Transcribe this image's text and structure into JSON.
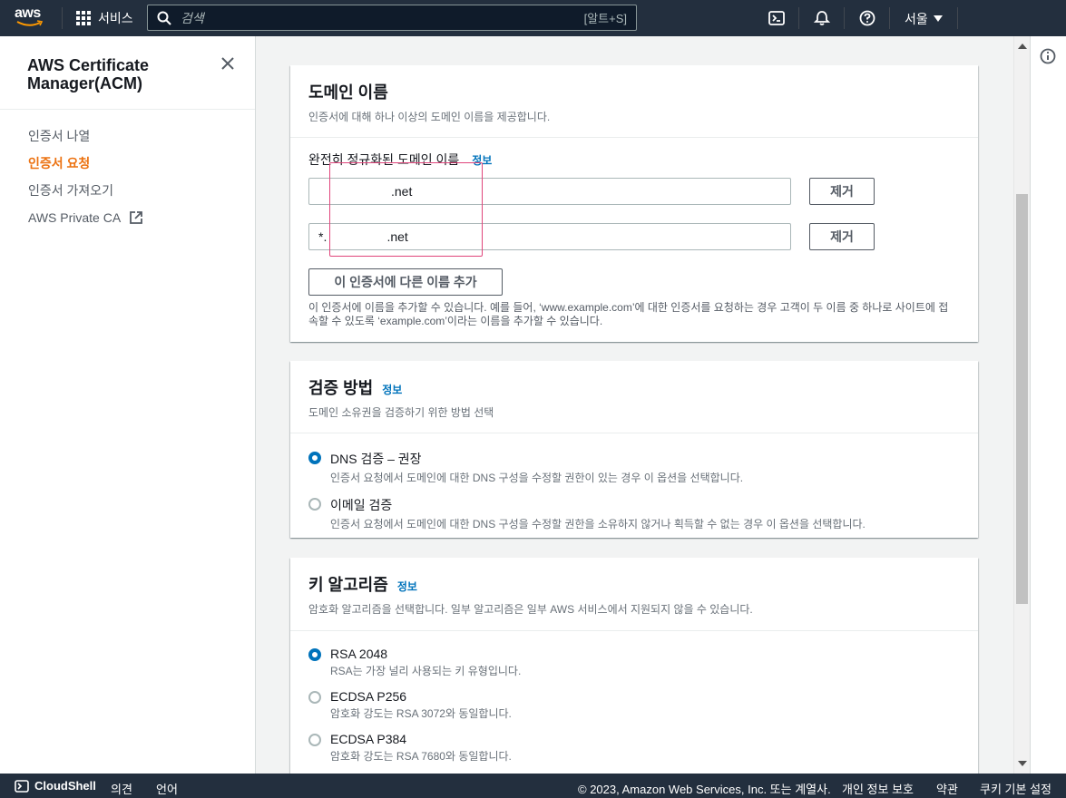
{
  "topnav": {
    "logo_text": "aws",
    "services_label": "서비스",
    "search_placeholder": "검색",
    "search_shortcut": "[알트+S]",
    "region_label": "서울"
  },
  "sidebar": {
    "title": "AWS Certificate Manager(ACM)",
    "items": [
      {
        "label": "인증서 나열"
      },
      {
        "label": "인증서 요청"
      },
      {
        "label": "인증서 가져오기"
      },
      {
        "label": "AWS Private CA"
      }
    ]
  },
  "domain_panel": {
    "title": "도메인 이름",
    "description": "인증서에 대해 하나 이상의 도메인 이름을 제공합니다.",
    "field_label": "완전히 정규화된 도메인 이름",
    "info_label": "정보",
    "domains": [
      {
        "value": ".net",
        "remove_label": "제거"
      },
      {
        "value": "*.                 .net",
        "remove_label": "제거"
      }
    ],
    "add_button_label": "이 인증서에 다른 이름 추가",
    "hint": "이 인증서에 이름을 추가할 수 있습니다. 예를 들어, ‘www.example.com’에 대한 인증서를 요청하는 경우 고객이 두 이름 중 하나로 사이트에 접속할 수 있도록 ‘example.com’이라는 이름을 추가할 수 있습니다."
  },
  "validation_panel": {
    "title": "검증 방법",
    "info_label": "정보",
    "description": "도메인 소유권을 검증하기 위한 방법 선택",
    "options": [
      {
        "label": "DNS 검증 – 권장",
        "description": "인증서 요청에서 도메인에 대한 DNS 구성을 수정할 권한이 있는 경우 이 옵션을 선택합니다.",
        "selected": true
      },
      {
        "label": "이메일 검증",
        "description": "인증서 요청에서 도메인에 대한 DNS 구성을 수정할 권한을 소유하지 않거나 획득할 수 없는 경우 이 옵션을 선택합니다.",
        "selected": false
      }
    ]
  },
  "key_panel": {
    "title": "키 알고리즘",
    "info_label": "정보",
    "description": "암호화 알고리즘을 선택합니다. 일부 알고리즘은 일부 AWS 서비스에서 지원되지 않을 수 있습니다.",
    "options": [
      {
        "label": "RSA 2048",
        "description": "RSA는 가장 널리 사용되는 키 유형입니다.",
        "selected": true
      },
      {
        "label": "ECDSA P256",
        "description": "암호화 강도는 RSA 3072와 동일합니다.",
        "selected": false
      },
      {
        "label": "ECDSA P384",
        "description": "암호화 강도는 RSA 7680와 동일합니다.",
        "selected": false
      }
    ]
  },
  "footer": {
    "cloudshell_label": "CloudShell",
    "feedback_label": "의견",
    "language_label": "언어",
    "copyright": "© 2023, Amazon Web Services, Inc. 또는 계열사.",
    "privacy_label": "개인 정보 보호",
    "terms_label": "약관",
    "cookie_label": "쿠키 기본 설정"
  },
  "colors": {
    "nav_bg": "#232f3e",
    "active_nav": "#ec7211",
    "link": "#0073bb",
    "highlight": "#e0457b"
  }
}
